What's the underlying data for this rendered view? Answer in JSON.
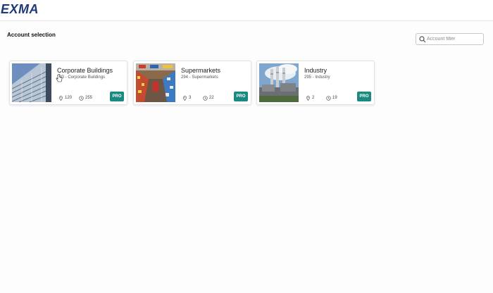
{
  "app": {
    "logo_text": "EXMA"
  },
  "page": {
    "title": "Account selection"
  },
  "filter": {
    "placeholder": "Account filter",
    "value": ""
  },
  "colors": {
    "brand": "#1d3a74",
    "pro_badge": "#1a8a80"
  },
  "accounts": [
    {
      "title": "Corporate Buildings",
      "subtitle": "293 - Corporate Buildings",
      "locations": "120",
      "meters": "255",
      "badge": "PRO",
      "image": "office-building"
    },
    {
      "title": "Supermarkets",
      "subtitle": "294 - Supermarkets",
      "locations": "3",
      "meters": "22",
      "badge": "PRO",
      "image": "supermarket-aisle"
    },
    {
      "title": "Industry",
      "subtitle": "295 - Industry",
      "locations": "2",
      "meters": "19",
      "badge": "PRO",
      "image": "industrial-plant"
    }
  ]
}
